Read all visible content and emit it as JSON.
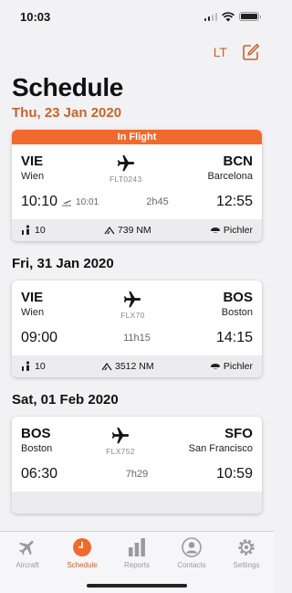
{
  "status": {
    "time": "10:03"
  },
  "nav": {
    "lt_label": "LT"
  },
  "page": {
    "title": "Schedule"
  },
  "sections": [
    {
      "date": "Thu, 23 Jan 2020",
      "flight": {
        "banner": "In Flight",
        "from_code": "VIE",
        "from_city": "Wien",
        "to_code": "BCN",
        "to_city": "Barcelona",
        "flight_no": "FLT0243",
        "dep_time": "10:10",
        "actual_dep": "10:01",
        "duration": "2h45",
        "arr_time": "12:55",
        "pax": "10",
        "distance": "739 NM",
        "captain": "Pichler"
      }
    },
    {
      "date": "Fri, 31 Jan 2020",
      "flight": {
        "from_code": "VIE",
        "from_city": "Wien",
        "to_code": "BOS",
        "to_city": "Boston",
        "flight_no": "FLX70",
        "dep_time": "09:00",
        "duration": "11h15",
        "arr_time": "14:15",
        "pax": "10",
        "distance": "3512 NM",
        "captain": "Pichler"
      }
    },
    {
      "date": "Sat, 01 Feb 2020",
      "flight": {
        "from_code": "BOS",
        "from_city": "Boston",
        "to_code": "SFO",
        "to_city": "San Francisco",
        "flight_no": "FLX752",
        "dep_time": "06:30",
        "duration": "7h29",
        "arr_time": "10:59"
      }
    }
  ],
  "tabs": [
    {
      "label": "Aircraft",
      "icon": "airplane-icon"
    },
    {
      "label": "Schedule",
      "icon": "clock-icon"
    },
    {
      "label": "Reports",
      "icon": "bar-chart-icon"
    },
    {
      "label": "Contacts",
      "icon": "person-icon"
    },
    {
      "label": "Settings",
      "icon": "gear-icon"
    }
  ],
  "colors": {
    "accent": "#c8642c",
    "banner": "#ef6a2c"
  }
}
